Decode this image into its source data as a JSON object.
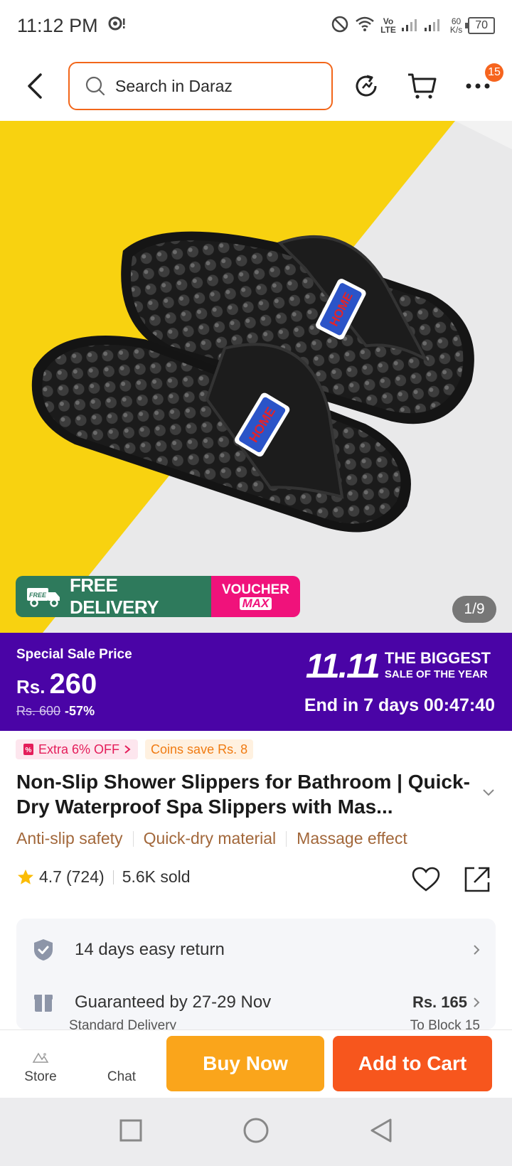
{
  "status_bar": {
    "time": "11:12 PM",
    "network_top": "Vo",
    "network_bottom": "LTE",
    "speed_value": "60",
    "speed_unit": "K/s",
    "battery": "70"
  },
  "header": {
    "search_placeholder": "Search in Daraz",
    "more_badge": "15"
  },
  "gallery": {
    "counter": "1/9",
    "promo_free_icon_text": "FREE",
    "promo_free_label": "FREE DELIVERY",
    "promo_voucher_line1": "VOUCHER",
    "promo_voucher_line2": "MAX"
  },
  "price_band": {
    "label": "Special Sale Price",
    "currency": "Rs.",
    "price": "260",
    "original_price": "Rs. 600",
    "discount": "-57%",
    "campaign_big": "11.11",
    "campaign_line1": "THE BIGGEST",
    "campaign_line2": "SALE OF THE YEAR",
    "countdown": "End in 7 days 00:47:40",
    "background_color": "#4a04a6"
  },
  "tags": {
    "extra": "Extra 6% OFF",
    "coins": "Coins save Rs. 8"
  },
  "product": {
    "title": "Non-Slip Shower Slippers for Bathroom | Quick-Dry Waterproof Spa Slippers with Mas...",
    "features": [
      "Anti-slip safety",
      "Quick-dry material",
      "Massage effect"
    ],
    "rating": "4.7",
    "reviews": "(724)",
    "sold": "5.6K sold"
  },
  "services": {
    "return_text": "14 days easy return",
    "delivery_text": "Guaranteed by 27-29 Nov",
    "delivery_price": "Rs. 165",
    "delivery_sub": "Standard Delivery",
    "delivery_location": "To Block 15"
  },
  "action_bar": {
    "store_label": "Store",
    "chat_label": "Chat",
    "buy_now": "Buy Now",
    "add_to_cart": "Add to Cart",
    "buy_color": "#faa51b",
    "cart_color": "#f7561d"
  }
}
